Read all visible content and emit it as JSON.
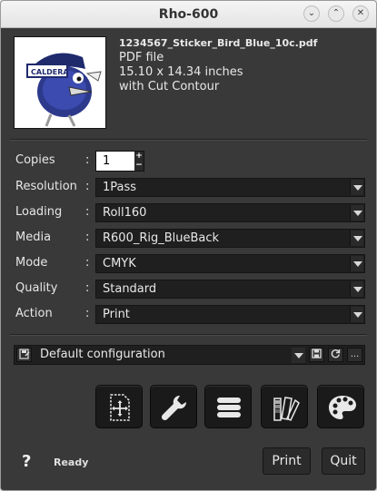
{
  "window": {
    "title": "Rho-600",
    "controls": [
      "minimize",
      "maximize",
      "close"
    ]
  },
  "file": {
    "name": "1234567_Sticker_Bird_Blue_10c.pdf",
    "type": "PDF file",
    "size": "15.10 x 14.34 inches",
    "contour": "with Cut Contour",
    "thumbnail_text": "CALDERA"
  },
  "settings": {
    "copies": {
      "label": "Copies",
      "value": "1"
    },
    "resolution": {
      "label": "Resolution",
      "value": "1Pass"
    },
    "loading": {
      "label": "Loading",
      "value": "Roll160"
    },
    "media": {
      "label": "Media",
      "value": "R600_Rig_BlueBack"
    },
    "mode": {
      "label": "Mode",
      "value": "CMYK"
    },
    "quality": {
      "label": "Quality",
      "value": "Standard"
    },
    "action": {
      "label": "Action",
      "value": "Print"
    },
    "colon": ":"
  },
  "configuration": {
    "value": "Default configuration",
    "more_label": "..."
  },
  "status": {
    "help": "?",
    "text": "Ready"
  },
  "buttons": {
    "print": "Print",
    "quit": "Quit"
  },
  "colors": {
    "background": "#393939",
    "field": "#1f1f1f",
    "text": "#e8e8e8"
  }
}
